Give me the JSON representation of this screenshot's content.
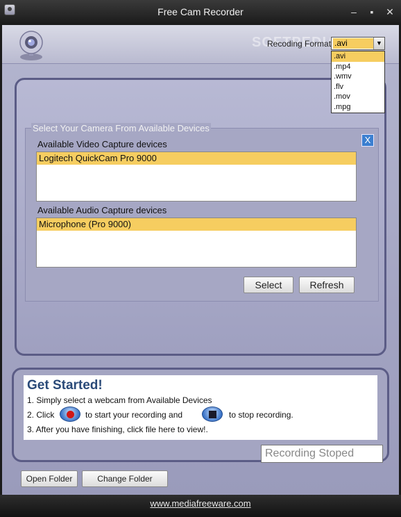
{
  "window": {
    "title": "Free Cam Recorder",
    "min": "–",
    "max": "▪",
    "close": "✕"
  },
  "header": {
    "watermark": "SOFTPEDIA",
    "format_label": "Recoding Format",
    "format_value": ".avi",
    "format_arrow": "▼",
    "format_options": [
      ".avi",
      ".mp4",
      ".wmv",
      ".flv",
      ".mov",
      ".mpg"
    ]
  },
  "devices": {
    "group_title": "Select Your Camera From Available Devices",
    "close_label": "X",
    "video_label": "Available Video Capture devices",
    "video_items": [
      "Logitech QuickCam Pro 9000"
    ],
    "audio_label": "Available Audio Capture devices",
    "audio_items": [
      "Microphone (Pro 9000)"
    ],
    "select_label": "Select",
    "refresh_label": "Refresh"
  },
  "get_started": {
    "title": "Get Started!",
    "step1": "1. Simply select a webcam from Available Devices",
    "step2_a": "2. Click",
    "step2_b": "to start your recording and",
    "step2_c": "to stop recording.",
    "step3": "3. After you have finishing, click file  here to view!."
  },
  "actions": {
    "open_folder": "Open Folder",
    "change_folder": "Change Folder"
  },
  "status": {
    "text": "Recording Stoped"
  },
  "footer": {
    "link": "www.mediafreeware.com"
  }
}
